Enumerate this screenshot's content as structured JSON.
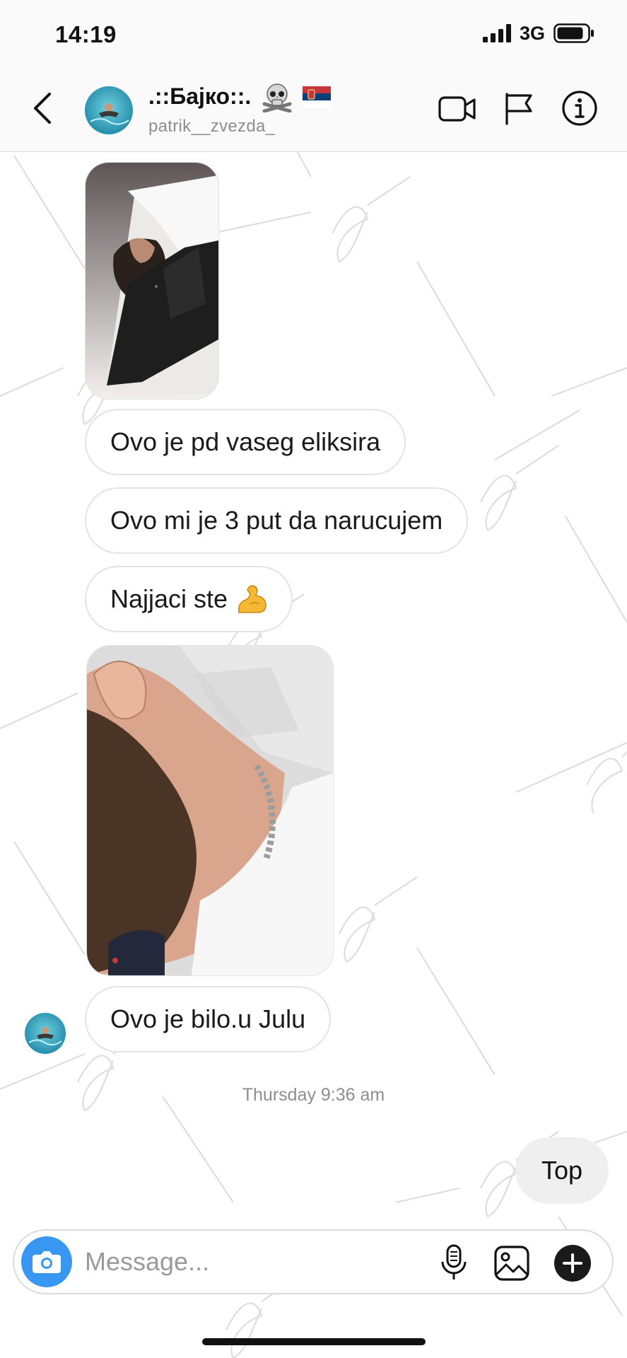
{
  "status_bar": {
    "time": "14:19",
    "network": "3G"
  },
  "header": {
    "contact_name": ".::Бајко::.",
    "contact_username": "patrik__zvezda_",
    "name_icons": [
      "skull-and-crossbones-icon",
      "serbian-flag-icon"
    ],
    "actions": [
      "video-call-icon",
      "flag-icon",
      "info-icon"
    ]
  },
  "messages": [
    {
      "type": "photo",
      "description_icon": "bearded-man-selfie-photo"
    },
    {
      "type": "text",
      "text": "Ovo je pd vaseg eliksira"
    },
    {
      "type": "text",
      "text": "Ovo mi je 3 put da narucujem"
    },
    {
      "type": "text",
      "text": "Najjaci ste",
      "emoji": "flexed-biceps-icon"
    },
    {
      "type": "photo",
      "description_icon": "beard-neck-closeup-photo"
    },
    {
      "type": "text",
      "text": "Ovo je bilo.u Julu"
    }
  ],
  "timestamp": "Thursday 9:36 am",
  "top_bubble": "Top",
  "composer": {
    "placeholder": "Message...",
    "icons": [
      "camera-icon",
      "microphone-icon",
      "gallery-icon",
      "plus-icon"
    ]
  },
  "colors": {
    "accent": "#3897f0",
    "header_bg": "#fafafa",
    "bubble_border": "#e3e3e3",
    "secondary_text": "#8e8e8e"
  }
}
